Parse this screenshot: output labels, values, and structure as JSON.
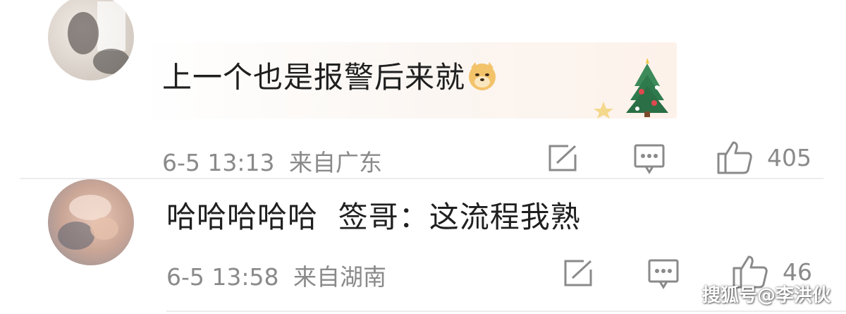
{
  "comments": [
    {
      "text": "上一个也是报警后来就",
      "emoji": "doge-emoji",
      "date": "6-5 13:13",
      "location": "来自广东",
      "like_count": "405"
    },
    {
      "text": "哈哈哈哈哈  签哥：这流程我熟",
      "date": "6-5 13:58",
      "location": "来自湖南",
      "like_count": "46"
    }
  ],
  "icons": {
    "share": "share-icon",
    "comment": "comment-icon",
    "like": "thumbs-up-icon"
  },
  "colors": {
    "text": "#1f1f1f",
    "meta": "#8a8a8a",
    "bubble_accent": "#fdf2ea"
  },
  "watermark": "搜狐号@李洪伙"
}
